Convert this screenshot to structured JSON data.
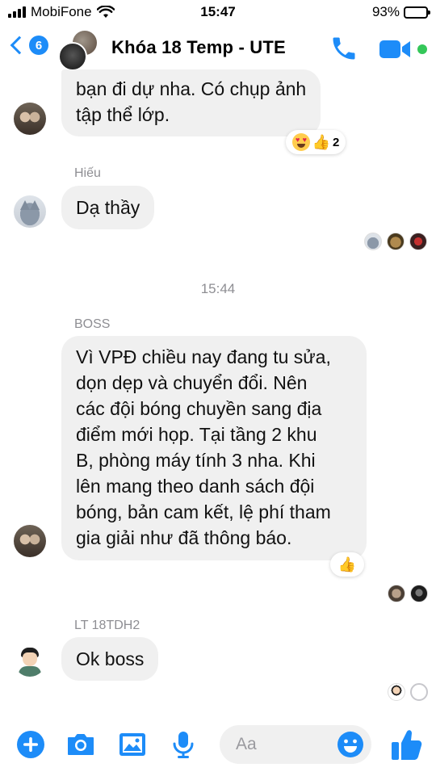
{
  "status_bar": {
    "carrier": "MobiFone",
    "time": "15:47",
    "battery": "93%",
    "battery_level": 0.93
  },
  "header": {
    "back_badge": "6",
    "title": "Khóa 18 Temp - UTE"
  },
  "messages": [
    {
      "sender": "",
      "text_lines": [
        "bạn đi dự nha. Có chụp ảnh",
        "tập thể lớp."
      ],
      "reactions": {
        "emojis": [
          "heart-eyes-emoji",
          "thumbs-up-emoji"
        ],
        "count": "2"
      }
    },
    {
      "sender": "Hiếu",
      "text_lines": [
        "Dạ thầy"
      ]
    },
    {
      "sender": "BOSS",
      "text_lines": [
        "Vì VPĐ chiều nay đang tu sửa,",
        "dọn dẹp và chuyển đổi. Nên",
        "các đội bóng chuyền sang địa",
        "điểm mới họp. Tại tầng 2 khu",
        "B, phòng máy tính 3 nha. Khi",
        "lên mang theo danh sách đội",
        "bóng, bản cam kết, lệ phí tham",
        "gia giải như đã thông báo."
      ],
      "reactions": {
        "emojis": [
          "thumbs-up-emoji"
        ]
      }
    },
    {
      "sender": "LT 18TDH2",
      "text_lines": [
        "Ok boss"
      ]
    }
  ],
  "timestamp": "15:44",
  "composer": {
    "placeholder": "Aa"
  },
  "colors": {
    "accent": "#1d8cf8",
    "bubble": "#f0f0f0",
    "online": "#34c759"
  }
}
